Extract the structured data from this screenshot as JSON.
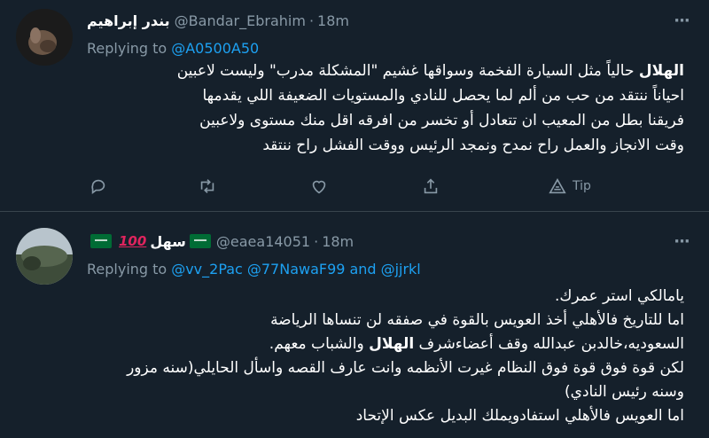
{
  "tweets": [
    {
      "display_name": "بندر إبراهيم",
      "handle": "@Bandar_Ebrahim",
      "separator": "·",
      "time": "18m",
      "replying_to_label": "Replying to",
      "replying_to": [
        "@A0500A50"
      ],
      "body_lines": [
        [
          "الهلال",
          " حالياً مثل السيارة الفخمة وسواقها غشيم \"المشكلة مدرب\" وليست لاعبين"
        ],
        [
          "",
          "احياناً ننتقد من حب من ألم لما يحصل للنادي والمستويات الضعيفة اللي يقدمها"
        ],
        [
          "",
          "فريقنا بطل من المعيب ان تتعادل أو تخسر من افرقه اقل منك مستوى ولاعبين"
        ],
        [
          "",
          "وقت الانجاز والعمل راح نمدح ونمجد الرئيس ووقت الفشل راح ننتقد"
        ]
      ],
      "actions": {
        "reply_icon": "reply-icon",
        "retweet_icon": "retweet-icon",
        "like_icon": "heart-icon",
        "share_icon": "share-icon",
        "tip_icon": "tip-icon",
        "tip_label": "Tip"
      }
    },
    {
      "display_name": "سهل",
      "emoji": "💯",
      "flag": "saudi-flag",
      "handle": "@eaea14051",
      "separator": "·",
      "time": "18m",
      "replying_to_label": "Replying to",
      "replying_to": [
        "@vv_2Pac",
        "@77NawaF99"
      ],
      "replying_and": "and",
      "replying_last": "@jjrkl",
      "body_lines": [
        "يامالكي استر عمرك.",
        "اما للتاريخ فالأهلي أخذ العويس بالقوة في صفقه لن تنساها الرياضة",
        [
          "السعوديه،خالدبن عبدالله وقف أعضاءشرف ",
          "الهلال",
          " والشباب معهم."
        ],
        "لكن قوة فوق قوة فوق النظام غيرت الأنظمه وانت عارف القصه واسأل الحايلي(سنه مزور",
        "وسنه رئيس النادي)",
        "اما العويس فالأهلي استفادويملك البديل عكس الإتحاد"
      ]
    }
  ],
  "colors": {
    "background": "#15202b",
    "divider": "#38444d",
    "muted": "#8899a6",
    "link": "#1da1f2",
    "text": "#ffffff"
  }
}
